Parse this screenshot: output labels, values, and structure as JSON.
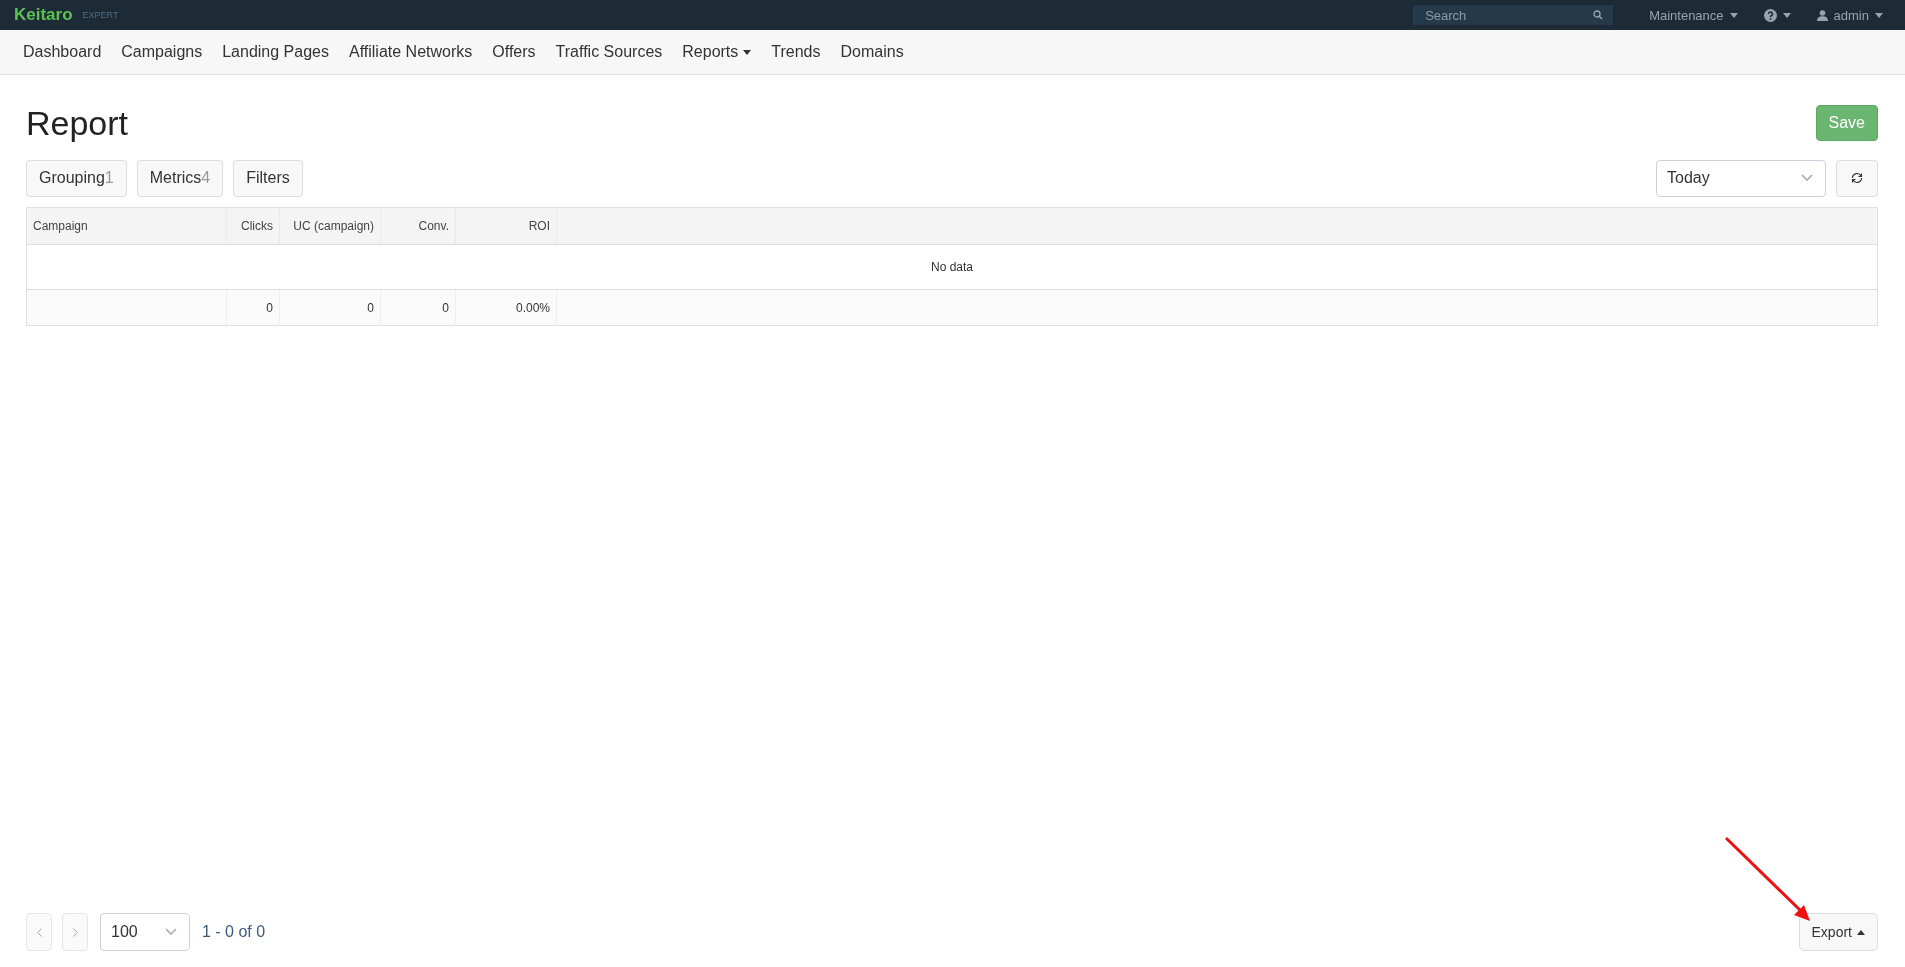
{
  "topbar": {
    "logo": "Keitaro",
    "edition": "EXPERT",
    "search": {
      "placeholder": "Search"
    },
    "menus": [
      {
        "kind": "text",
        "label": "Maintenance"
      },
      {
        "kind": "help"
      },
      {
        "kind": "user",
        "label": "admin"
      }
    ]
  },
  "nav": [
    {
      "label": "Dashboard",
      "dropdown": false
    },
    {
      "label": "Campaigns",
      "dropdown": false
    },
    {
      "label": "Landing Pages",
      "dropdown": false
    },
    {
      "label": "Affiliate Networks",
      "dropdown": false
    },
    {
      "label": "Offers",
      "dropdown": false
    },
    {
      "label": "Traffic Sources",
      "dropdown": false
    },
    {
      "label": "Reports",
      "dropdown": true
    },
    {
      "label": "Trends",
      "dropdown": false
    },
    {
      "label": "Domains",
      "dropdown": false
    }
  ],
  "page": {
    "title": "Report",
    "save": "Save"
  },
  "toolbar": {
    "buttons": [
      {
        "label": "Grouping",
        "count": "1"
      },
      {
        "label": "Metrics",
        "count": "4"
      },
      {
        "label": "Filters"
      }
    ],
    "period": "Today"
  },
  "table": {
    "columns": [
      {
        "label": "Campaign"
      },
      {
        "label": "Clicks"
      },
      {
        "label": "UC (campaign)"
      },
      {
        "label": "Conv."
      },
      {
        "label": "ROI"
      }
    ],
    "empty": "No data",
    "totals": [
      "0",
      "0",
      "0",
      "0.00%"
    ]
  },
  "pagination": {
    "per_page": "100",
    "range": "1 - 0 of 0"
  },
  "export": "Export"
}
